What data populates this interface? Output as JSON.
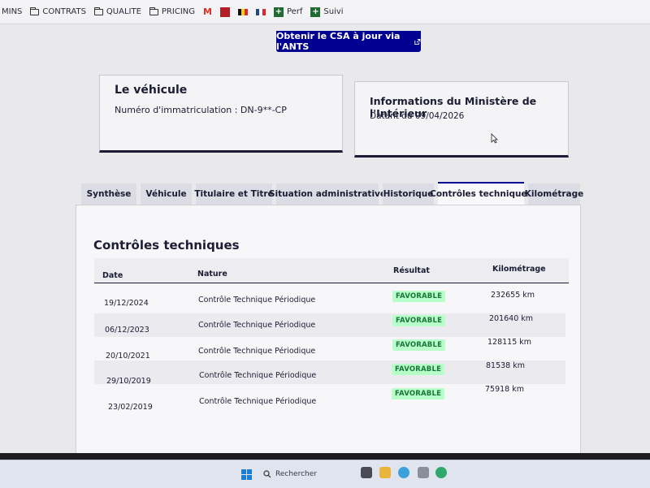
{
  "bookmarks": [
    {
      "label": "MINS",
      "icon": "folder-icon"
    },
    {
      "label": "CONTRATS",
      "icon": "folder-icon"
    },
    {
      "label": "QUALITE",
      "icon": "folder-icon"
    },
    {
      "label": "PRICING",
      "icon": "folder-icon"
    },
    {
      "label": "Perf",
      "icon": "plus-icon"
    },
    {
      "label": "Suivi",
      "icon": "plus-icon"
    }
  ],
  "ants_button": {
    "label": "Obtenir le CSA à jour via l'ANTS",
    "icon": "external-link-icon"
  },
  "vehicule_card": {
    "title": "Le véhicule",
    "plate_line": "Numéro d'immatriculation : DN-9**-CP"
  },
  "ministere_card": {
    "title": "Informations du Ministère de l'Intérieur",
    "date_line": "Datant du 09/04/2026"
  },
  "tabs": [
    {
      "label": "Synthèse"
    },
    {
      "label": "Véhicule"
    },
    {
      "label": "Titulaire et Titre"
    },
    {
      "label": "Situation administrative"
    },
    {
      "label": "Historique"
    },
    {
      "label": "Contrôles techniques"
    },
    {
      "label": "Kilométrage"
    }
  ],
  "active_tab": "Contrôles techniques",
  "panel": {
    "title": "Contrôles techniques",
    "columns": [
      "Date",
      "Nature",
      "Résultat",
      "Kilométrage"
    ],
    "rows": [
      {
        "date": "19/12/2024",
        "nature": "Contrôle Technique Périodique",
        "result": "FAVORABLE",
        "km": "232655 km"
      },
      {
        "date": "06/12/2023",
        "nature": "Contrôle Technique Périodique",
        "result": "FAVORABLE",
        "km": "201640 km"
      },
      {
        "date": "20/10/2021",
        "nature": "Contrôle Technique Périodique",
        "result": "FAVORABLE",
        "km": "128115 km"
      },
      {
        "date": "29/10/2019",
        "nature": "Contrôle Technique Périodique",
        "result": "FAVORABLE",
        "km": "81538 km"
      },
      {
        "date": "23/02/2019",
        "nature": "Contrôle Technique Périodique",
        "result": "FAVORABLE",
        "km": "75918 km"
      }
    ]
  },
  "taskbar": {
    "search_placeholder": "Rechercher"
  },
  "colors": {
    "brand_blue": "#000091",
    "badge_bg": "#b8fec9",
    "badge_text": "#18753c",
    "dark_text": "#1c1c34"
  }
}
